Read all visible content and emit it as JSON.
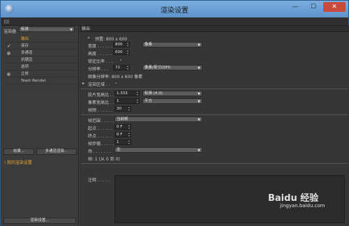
{
  "window": {
    "title": "渲染设置",
    "min": "—",
    "max": "☐",
    "close": "✕"
  },
  "left": {
    "renderer_label": "渲染器",
    "renderer_value": "标准",
    "items": [
      {
        "label": "输出",
        "checked": false
      },
      {
        "label": "保存",
        "checked": true
      },
      {
        "label": "多通道",
        "checked": false
      },
      {
        "label": "抗锯齿",
        "checked": false
      },
      {
        "label": "选项",
        "checked": false
      },
      {
        "label": "立体",
        "checked": false
      },
      {
        "label": "Team Render",
        "checked": false
      }
    ],
    "effects_btn": "效果...",
    "multipass_btn": "多通道渲染...",
    "my_settings": "我的渲染设置",
    "render_settings_btn": "渲染设置..."
  },
  "output": {
    "section": "输出",
    "preset_label": "预置: 800 x 600",
    "width_label": "宽度 . . . . . .",
    "width": "800",
    "unit": "像素",
    "height_label": "高度 . . . . . .",
    "height": "600",
    "lock_label": "锁定比率 . . .",
    "resolution_label": "分辨率 . . .",
    "resolution": "72",
    "res_unit": "像素/英寸(DPI)",
    "image_res": "图像分辨率:  800 x 600 像素",
    "render_region": "渲染区域 . .",
    "film_label": "胶片宽高比 . . .",
    "film": "1.333",
    "film_std": "标准 (4:3)",
    "pixel_label": "像素宽高比 . . .",
    "pixel": "1",
    "pixel_std": "平方",
    "fps_label": "帧频 . . . . . .",
    "fps": "30",
    "range_label": "帧范围 . . . . .",
    "range": "当前帧",
    "start_label": "起点 . . . . . .",
    "start": "0 F",
    "end_label": "终点 . . . . . .",
    "end": "0 F",
    "step_label": "帧步幅 . . . . .",
    "step": "1",
    "fields_label": "场 . . . . . . .",
    "fields": "无",
    "frames": "帧:     1 (从 0 到 0)",
    "notes_label": "注释 . . . . ."
  },
  "watermark": {
    "brand": "Baidu 经验",
    "url": "jingyan.baidu.com"
  }
}
